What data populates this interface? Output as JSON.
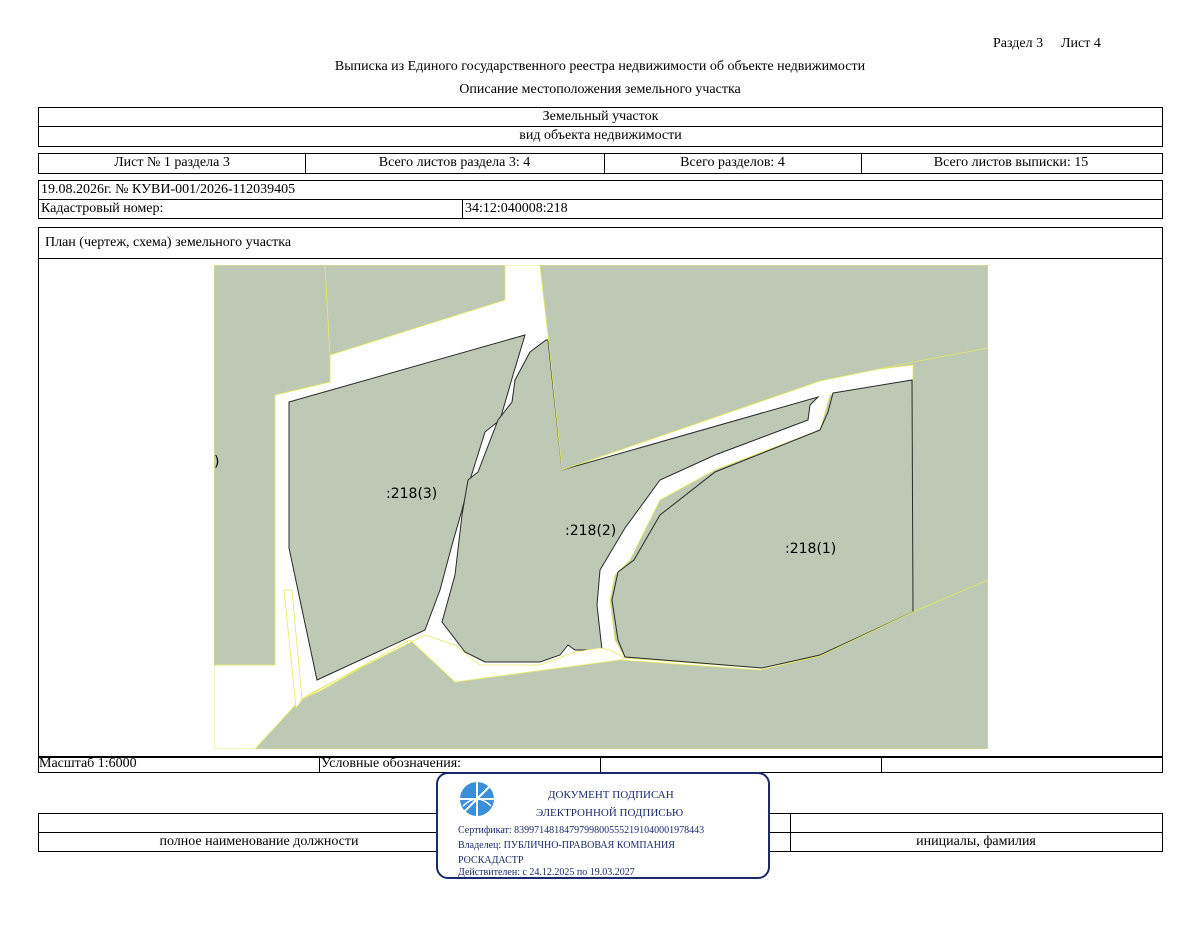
{
  "page_header": {
    "section": "Раздел 3",
    "sheet": "Лист 4"
  },
  "title": "Выписка из Единого государственного реестра недвижимости об объекте недвижимости",
  "subtitle": "Описание местоположения земельного участка",
  "object_type": {
    "value": "Земельный участок",
    "caption": "вид объекта недвижимости"
  },
  "sheet_info": {
    "sheet_of_section": "Лист № 1 раздела 3",
    "total_sheets_section": "Всего листов раздела 3: 4",
    "total_sections": "Всего разделов: 4",
    "total_sheets_extract": "Всего листов выписки: 15"
  },
  "extract_ref": "19.08.2026г. № КУВИ-001/2026-112039405",
  "cadastral": {
    "label": "Кадастровый номер:",
    "value": "34:12:040008:218"
  },
  "plan": {
    "title": "План (чертеж, схема) земельного участка",
    "contours": [
      ":218(3)",
      ":218(2)",
      ":218(1)"
    ],
    "edge_fragment": ")"
  },
  "scale": "Масштаб 1:6000",
  "legend_label": "Условные обозначения:",
  "signature": {
    "position_caption": "полное наименование должности",
    "name_caption": "инициалы, фамилия"
  },
  "stamp": {
    "line1": "ДОКУМЕНТ ПОДПИСАН",
    "line2": "ЭЛЕКТРОННОЙ ПОДПИСЬЮ",
    "certificate": "Сертификат: 839971481847979980055521910400019784​43",
    "owner_line1": "Владелец: ПУБЛИЧНО-ПРАВОВАЯ КОМПАНИЯ",
    "owner_line2": "РОСКАДАСТР",
    "validity": "Действителен: с 24.12.2025 по 19.03.2027"
  },
  "colors": {
    "map_fill": "#bdc9b5",
    "stamp_blue": "#1a2a6c",
    "boundary_yellow": "#e8e860"
  }
}
